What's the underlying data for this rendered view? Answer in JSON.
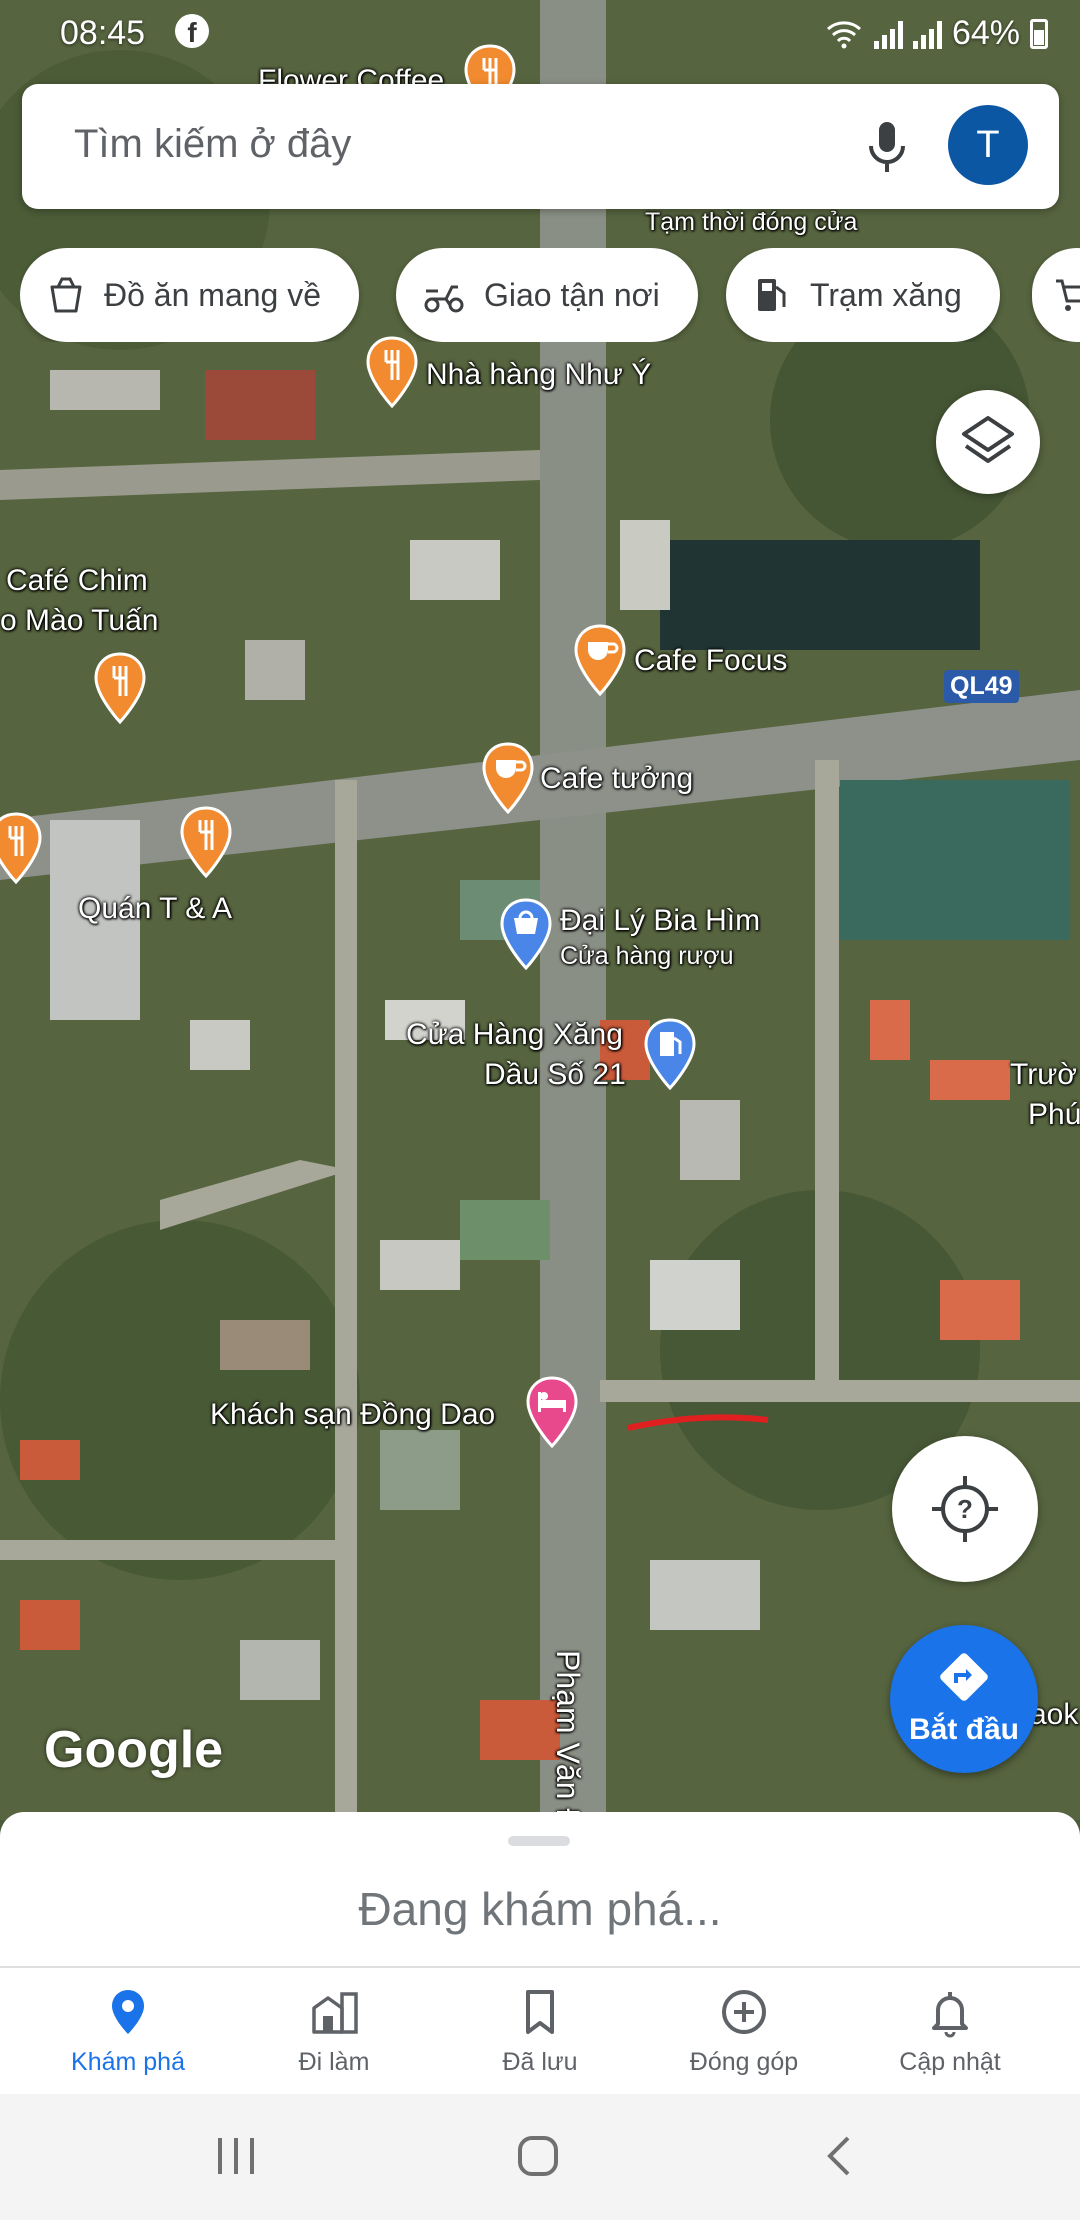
{
  "status_bar": {
    "time": "08:45",
    "battery": "64%"
  },
  "search": {
    "placeholder": "Tìm kiếm ở đây",
    "avatar_letter": "T"
  },
  "chips": [
    {
      "label": "Đồ ăn mang về",
      "icon": "takeout-icon"
    },
    {
      "label": "Giao tận nơi",
      "icon": "delivery-icon"
    },
    {
      "label": "Trạm xăng",
      "icon": "gas-station-icon"
    }
  ],
  "map_labels": {
    "flower_coffee": "Flower Coffee",
    "temp_closed": "Tạm thời đóng cửa",
    "nha_hang": "Nhà hàng Như Ý",
    "cafe_chim_1": "Café Chim",
    "cafe_chim_2": "o Mào Tuấn",
    "cafe_focus": "Cafe Focus",
    "road_ql49": "QL49",
    "cafe_tuong": "Cafe tưởng",
    "quan_ta": "Quán T & A",
    "dai_ly": "Đại Lý Bia Hìm",
    "dai_ly_sub": "Cửa hàng rượu",
    "xang_1": "Cửa Hàng Xăng",
    "xang_2": "Dầu Số 21",
    "truong_1": "Trườ",
    "truong_2": "Phú",
    "khach_san": "Khách sạn Đồng Dao",
    "pham_van": "Phạm Văn Đ",
    "aok": "aok",
    "google": "Google"
  },
  "start_button": {
    "label": "Bắt đầu"
  },
  "sheet": {
    "text": "Đang khám phá..."
  },
  "nav": [
    {
      "label": "Khám phá",
      "active": true
    },
    {
      "label": "Đi làm",
      "active": false
    },
    {
      "label": "Đã lưu",
      "active": false
    },
    {
      "label": "Đóng góp",
      "active": false
    },
    {
      "label": "Cập nhật",
      "active": false
    }
  ],
  "colors": {
    "accent": "#1a73e8",
    "avatar": "#0b57a3",
    "food_pin": "#f28b30",
    "shop_pin": "#4a86e8",
    "hotel_pin": "#e8488c"
  }
}
